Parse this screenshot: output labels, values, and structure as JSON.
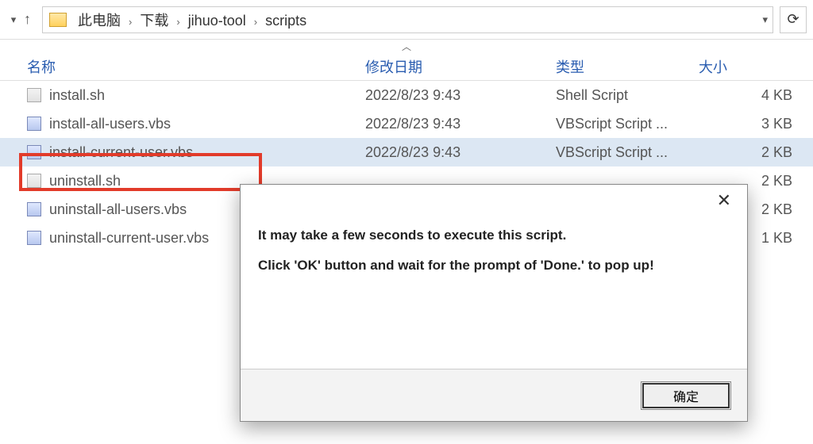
{
  "breadcrumbs": [
    "此电脑",
    "下载",
    "jihuo-tool",
    "scripts"
  ],
  "columns": {
    "name": "名称",
    "date": "修改日期",
    "type": "类型",
    "size": "大小"
  },
  "files": [
    {
      "name": "install.sh",
      "date": "2022/8/23 9:43",
      "type": "Shell Script",
      "size": "4 KB",
      "icon": "sh"
    },
    {
      "name": "install-all-users.vbs",
      "date": "2022/8/23 9:43",
      "type": "VBScript Script ...",
      "size": "3 KB",
      "icon": "vbs"
    },
    {
      "name": "install-current-user.vbs",
      "date": "2022/8/23 9:43",
      "type": "VBScript Script ...",
      "size": "2 KB",
      "icon": "vbs",
      "selected": true
    },
    {
      "name": "uninstall.sh",
      "date": "",
      "type": "",
      "size": "2 KB",
      "icon": "sh"
    },
    {
      "name": "uninstall-all-users.vbs",
      "date": "",
      "type": "",
      "size": "2 KB",
      "icon": "vbs"
    },
    {
      "name": "uninstall-current-user.vbs",
      "date": "",
      "type": "",
      "size": "1 KB",
      "icon": "vbs"
    }
  ],
  "dialog": {
    "line1": "It may take a few seconds to execute this script.",
    "line2": "Click 'OK' button and wait for the prompt of 'Done.' to pop up!",
    "ok": "确定"
  }
}
